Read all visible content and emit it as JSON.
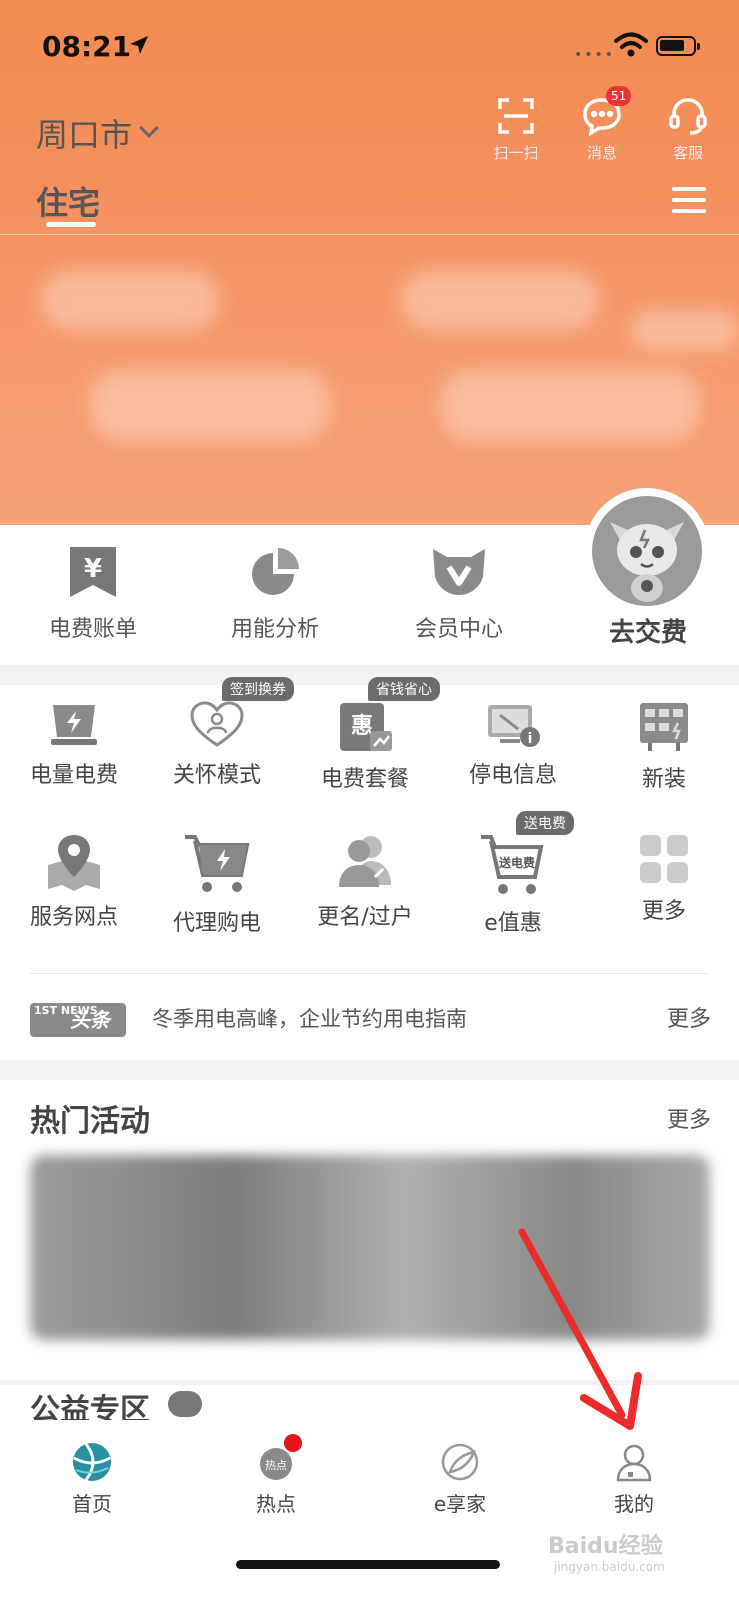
{
  "status_bar": {
    "time": "08:21"
  },
  "header": {
    "city": "周口市",
    "actions": [
      {
        "label": "扫一扫",
        "icon": "scan-icon"
      },
      {
        "label": "消息",
        "icon": "message-icon",
        "badge": "51"
      },
      {
        "label": "客服",
        "icon": "headset-icon"
      }
    ],
    "tab": "住宅"
  },
  "quick_actions": [
    {
      "label": "电费账单",
      "icon": "bill-icon"
    },
    {
      "label": "用能分析",
      "icon": "pie-chart-icon"
    },
    {
      "label": "会员中心",
      "icon": "vip-icon"
    }
  ],
  "pay_button": "去交费",
  "services": {
    "row1": [
      {
        "label": "电量电费",
        "icon": "electricity-icon",
        "tag": ""
      },
      {
        "label": "关怀模式",
        "icon": "care-heart-icon",
        "tag": "签到换券"
      },
      {
        "label": "电费套餐",
        "icon": "plan-icon",
        "tag": "省钱省心"
      },
      {
        "label": "停电信息",
        "icon": "outage-icon",
        "tag": ""
      },
      {
        "label": "新装",
        "icon": "meter-icon",
        "tag": ""
      }
    ],
    "row2": [
      {
        "label": "服务网点",
        "icon": "map-pin-icon",
        "tag": ""
      },
      {
        "label": "代理购电",
        "icon": "cart-bolt-icon",
        "tag": ""
      },
      {
        "label": "更名/过户",
        "icon": "users-icon",
        "tag": ""
      },
      {
        "label": "e值惠",
        "icon": "cart-gift-icon",
        "tag": "送电费"
      },
      {
        "label": "更多",
        "icon": "grid-icon",
        "tag": ""
      }
    ],
    "plan_icon_char": "惠",
    "cart_text": "送电费"
  },
  "news": {
    "logo_small": "1ST NEWS",
    "logo_text": "头条",
    "headline": "冬季用电高峰，企业节约用电指南",
    "more": "更多"
  },
  "hot_activities": {
    "title": "热门活动",
    "more": "更多"
  },
  "public_zone": {
    "title": "公益专区"
  },
  "tab_bar": [
    {
      "label": "首页",
      "icon": "home-globe-icon"
    },
    {
      "label": "热点",
      "icon": "hot-icon"
    },
    {
      "label": "e享家",
      "icon": "leaf-icon"
    },
    {
      "label": "我的",
      "icon": "profile-icon"
    }
  ],
  "watermark": {
    "main": "Baidu经验",
    "sub": "jingyan.baidu.com"
  },
  "colors": {
    "header_orange": "#f48a4f",
    "badge_red": "#e5151b",
    "annotation_arrow": "#ee2b2b"
  }
}
